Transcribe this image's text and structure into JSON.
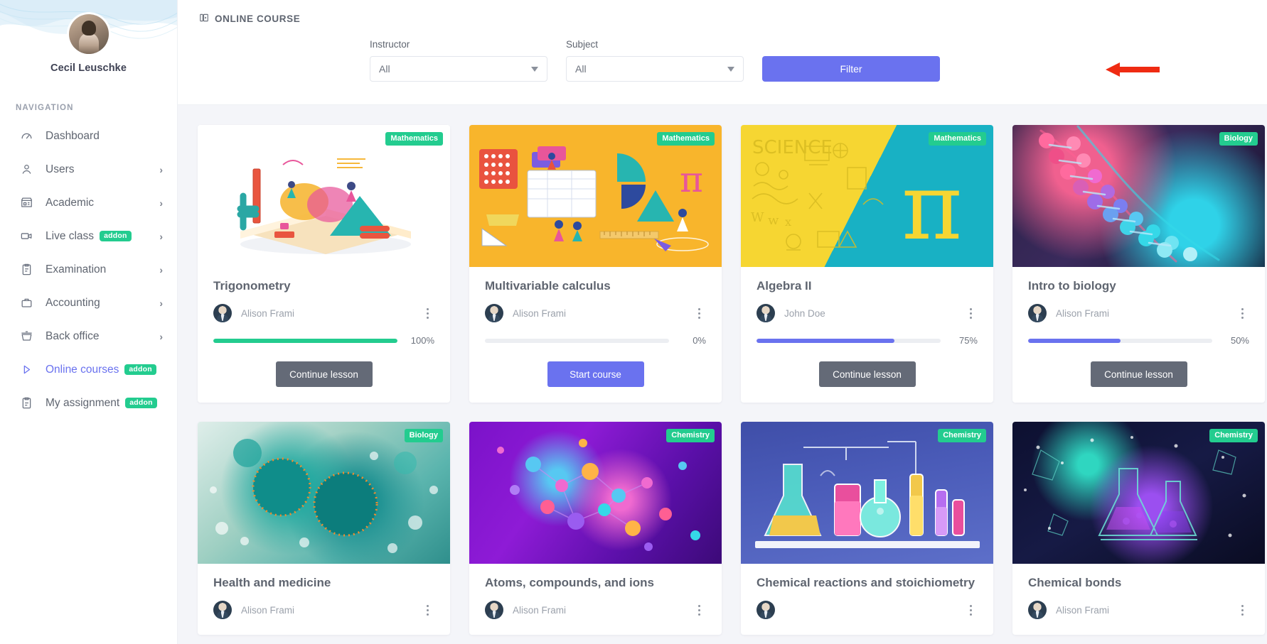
{
  "sidebar": {
    "profile_name": "Cecil Leuschke",
    "avatar_name": "user-avatar",
    "nav_title": "NAVIGATION",
    "items": [
      {
        "label": "Dashboard",
        "icon": "dashboard-icon",
        "addon": "",
        "chevron": false,
        "active": false
      },
      {
        "label": "Users",
        "icon": "user-icon",
        "addon": "",
        "chevron": true,
        "active": false
      },
      {
        "label": "Academic",
        "icon": "academic-icon",
        "addon": "",
        "chevron": true,
        "active": false
      },
      {
        "label": "Live class",
        "icon": "video-camera-icon",
        "addon": "addon",
        "chevron": true,
        "active": false
      },
      {
        "label": "Examination",
        "icon": "clipboard-icon",
        "addon": "",
        "chevron": true,
        "active": false
      },
      {
        "label": "Accounting",
        "icon": "briefcase-icon",
        "addon": "",
        "chevron": true,
        "active": false
      },
      {
        "label": "Back office",
        "icon": "printer-icon",
        "addon": "",
        "chevron": true,
        "active": false
      },
      {
        "label": "Online courses",
        "icon": "play-triangle-icon",
        "addon": "addon",
        "chevron": false,
        "active": true
      },
      {
        "label": "My assignment",
        "icon": "assignment-icon",
        "addon": "addon",
        "chevron": false,
        "active": false
      }
    ]
  },
  "panel": {
    "title": "ONLINE COURSE",
    "title_icon": "book-icon",
    "instructor": {
      "label": "Instructor",
      "value": "All",
      "placeholder": "All"
    },
    "subject": {
      "label": "Subject",
      "value": "All",
      "placeholder": "All"
    },
    "filter_button": "Filter",
    "annotation": "red-arrow-pointing-to-filter-button"
  },
  "colors": {
    "accent": "#6a72ef",
    "success": "#23cc8f",
    "badge": "#23cc8f",
    "grey_button": "#646a77",
    "track": "#eceef2",
    "annotation_arrow": "#ef2b12"
  },
  "courses": [
    {
      "title": "Trigonometry",
      "subject": "Mathematics",
      "instructor": "Alison Frami",
      "progress": 100,
      "progress_label": "100%",
      "progress_color": "#23cc8f",
      "action": "Continue lesson",
      "action_style": "grey",
      "art": "ill-trig"
    },
    {
      "title": "Multivariable calculus",
      "subject": "Mathematics",
      "instructor": "Alison Frami",
      "progress": 0,
      "progress_label": "0%",
      "progress_color": "#6a72ef",
      "action": "Start course",
      "action_style": "blue",
      "art": "ill-calc"
    },
    {
      "title": "Algebra II",
      "subject": "Mathematics",
      "instructor": "John Doe",
      "progress": 75,
      "progress_label": "75%",
      "progress_color": "#6a72ef",
      "action": "Continue lesson",
      "action_style": "grey",
      "art": "ill-alg"
    },
    {
      "title": "Intro to biology",
      "subject": "Biology",
      "instructor": "Alison Frami",
      "progress": 50,
      "progress_label": "50%",
      "progress_color": "#6a72ef",
      "action": "Continue lesson",
      "action_style": "grey",
      "art": "ill-bio"
    },
    {
      "title": "Health and medicine",
      "subject": "Biology",
      "instructor": "Alison Frami",
      "progress": 0,
      "progress_label": "",
      "progress_color": "#6a72ef",
      "action": "",
      "action_style": "grey",
      "art": "ill-health"
    },
    {
      "title": "Atoms, compounds, and ions",
      "subject": "Chemistry",
      "instructor": "Alison Frami",
      "progress": 0,
      "progress_label": "",
      "progress_color": "#6a72ef",
      "action": "",
      "action_style": "grey",
      "art": "ill-atoms"
    },
    {
      "title": "Chemical reactions and stoichiometry",
      "subject": "Chemistry",
      "instructor": "",
      "progress": 0,
      "progress_label": "",
      "progress_color": "#6a72ef",
      "action": "",
      "action_style": "grey",
      "art": "ill-chem"
    },
    {
      "title": "Chemical bonds",
      "subject": "Chemistry",
      "instructor": "Alison Frami",
      "progress": 0,
      "progress_label": "",
      "progress_color": "#6a72ef",
      "action": "",
      "action_style": "grey",
      "art": "ill-bonds"
    }
  ]
}
